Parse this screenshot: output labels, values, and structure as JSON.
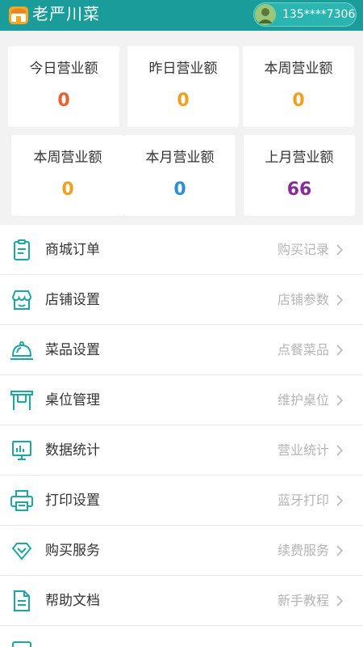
{
  "header": {
    "shop_name": "老严川菜",
    "phone": "135****7306",
    "accent_color": "#1a9c9a"
  },
  "stats": [
    {
      "label": "今日营业额",
      "value": "0",
      "color": "#e8612c"
    },
    {
      "label": "昨日营业额",
      "value": "0",
      "color": "#f0a020"
    },
    {
      "label": "本周营业额",
      "value": "0",
      "color": "#f0a020"
    },
    {
      "label": "本周营业额",
      "value": "0",
      "color": "#f0a020"
    },
    {
      "label": "本月营业额",
      "value": "0",
      "color": "#2b8fd6"
    },
    {
      "label": "上月营业额",
      "value": "66",
      "color": "#8a2a9a"
    }
  ],
  "menu": [
    {
      "label": "商城订单",
      "hint": "购买记录",
      "icon": "clipboard-icon"
    },
    {
      "label": "店铺设置",
      "hint": "店铺参数",
      "icon": "storefront-icon"
    },
    {
      "label": "菜品设置",
      "hint": "点餐菜品",
      "icon": "food-cloche-icon"
    },
    {
      "label": "桌位管理",
      "hint": "维护桌位",
      "icon": "table-icon"
    },
    {
      "label": "数据统计",
      "hint": "营业统计",
      "icon": "monitor-chart-icon"
    },
    {
      "label": "打印设置",
      "hint": "蓝牙打印",
      "icon": "printer-icon"
    },
    {
      "label": "购买服务",
      "hint": "续费服务",
      "icon": "diamond-icon"
    },
    {
      "label": "帮助文档",
      "hint": "新手教程",
      "icon": "document-icon"
    }
  ]
}
